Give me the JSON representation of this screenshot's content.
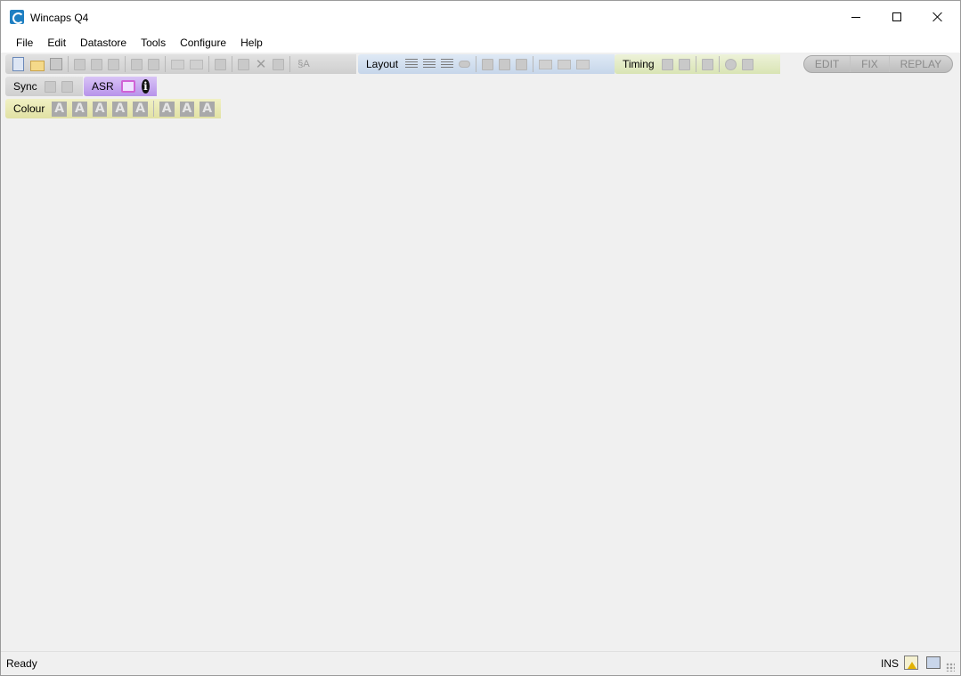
{
  "window": {
    "title": "Wincaps Q4"
  },
  "menu": [
    "File",
    "Edit",
    "Datastore",
    "Tools",
    "Configure",
    "Help"
  ],
  "toolbars": {
    "layout_label": "Layout",
    "timing_label": "Timing",
    "sync_label": "Sync",
    "asr_label": "ASR",
    "colour_label": "Colour",
    "colour_glyph": "A",
    "info_glyph": "i",
    "format_glyph": "§A",
    "delete_glyph": "✕"
  },
  "modes": [
    "EDIT",
    "FIX",
    "REPLAY"
  ],
  "status": {
    "text": "Ready",
    "ins": "INS"
  },
  "colors": {
    "layout": "#c6d6ea",
    "timing": "#d9e4b4",
    "asr": "#b793ea",
    "colour": "#e1e1a4"
  }
}
